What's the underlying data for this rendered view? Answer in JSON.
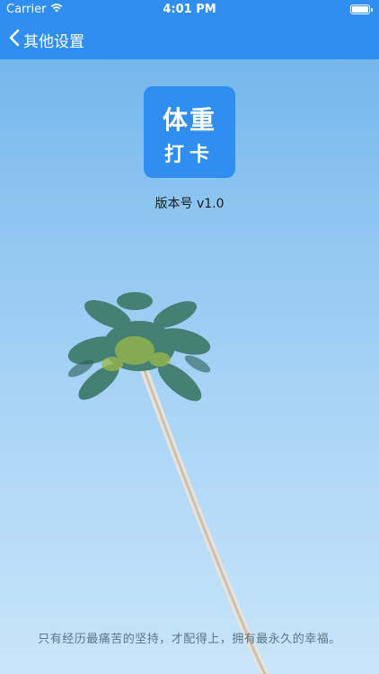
{
  "status_bar": {
    "carrier": "Carrier",
    "time": "4:01 PM"
  },
  "nav": {
    "back_label": "其他设置"
  },
  "logo": {
    "line1": "体重",
    "line2": "打卡"
  },
  "version_text": "版本号 v1.0",
  "motto": "只有经历最痛苦的坚持，才配得上，拥有最永久的幸福。",
  "colors": {
    "accent": "#2f8ef0",
    "sky_top": "#6cb1ea",
    "sky_bottom": "#c8e5fa"
  }
}
